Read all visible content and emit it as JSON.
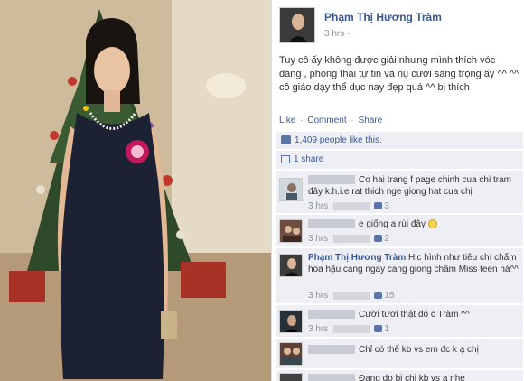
{
  "post": {
    "author": "Phạm Thị Hương Tràm",
    "time": "3 hrs ·",
    "text": "Tuy cô ấy không được giải nhưng mình thích vóc dáng , phong thái tự tin và nụ cười sang trọng ấy ^^ ^^ cô giáo dạy thể dục nay đẹp quá ^^ bị thích",
    "actions": {
      "like": "Like",
      "comment": "Comment",
      "share": "Share",
      "sep": "·"
    },
    "likes": "1,409 people like this.",
    "shares": "1 share"
  },
  "comments": [
    {
      "text": "Co hai trang f page chinh cua chi tram đây k.h.i.e rat thich nge giong hat cua chị",
      "time": "3 hrs ·",
      "likes": "3"
    },
    {
      "text": "e giống a rùi đây",
      "time": "3 hrs ·",
      "likes": "2"
    },
    {
      "name": "Phạm Thị Hương Tràm",
      "text": "Hic hình như tiêu chí chấm hoa hậu cang ngay cang giong chấm Miss teen hà^^",
      "time": "3 hrs ·",
      "likes": "15"
    },
    {
      "text": "Cười tươi thật đó c Tràm ^^",
      "time": "3 hrs ·",
      "likes": "1"
    },
    {
      "text": "Chỉ có thể kb vs em đc k ạ chị"
    },
    {
      "text": "Đang do bị chỉ kb vs a nhe"
    }
  ],
  "colors": {
    "link": "#3b5998",
    "bar": "#edeff4",
    "dress": "#1c2233"
  }
}
